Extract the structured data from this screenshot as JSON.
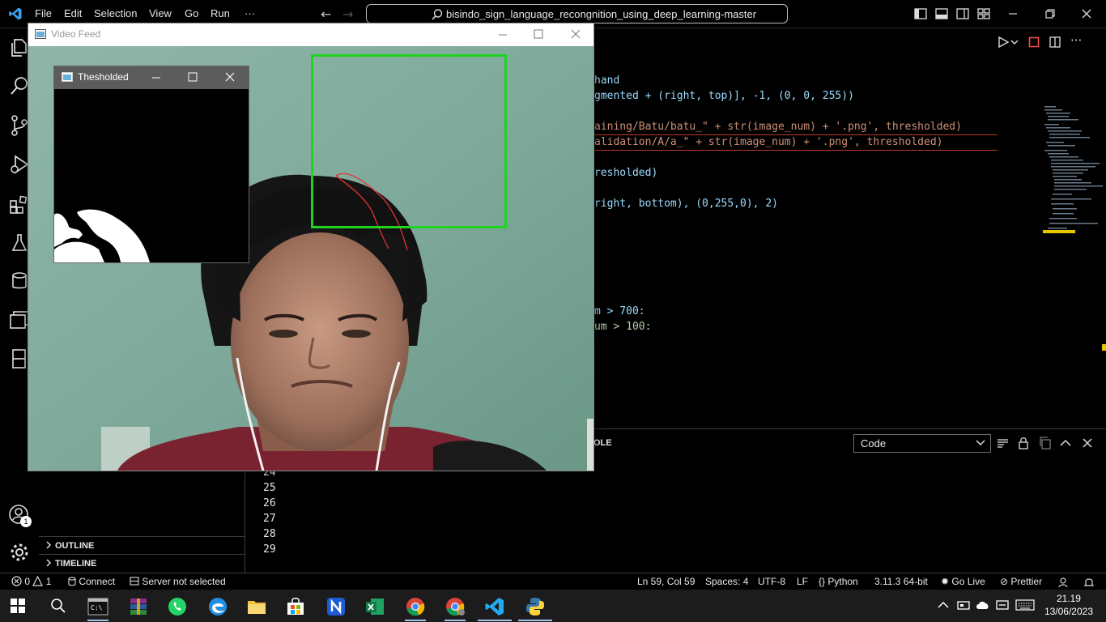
{
  "titlebar": {
    "menus": [
      "File",
      "Edit",
      "Selection",
      "View",
      "Go",
      "Run",
      "···"
    ],
    "search_text": "bisindo_sign_language_recongnition_using_deep_learning-master"
  },
  "code": {
    "lines": [
      {
        "text": "hand"
      },
      {
        "text": "gmented + (right, top)], -1, (0, 0, 255))"
      },
      {
        "text": "aining/Batu/batu_\" + str(image_num) + '.png', thresholded)"
      },
      {
        "text": "alidation/A/a_\" + str(image_num) + '.png', thresholded)"
      },
      {
        "text": "resholded)"
      },
      {
        "text": "right, bottom), (0,255,0), 2)"
      },
      {
        "text": "m > 700:"
      },
      {
        "text": "um > 100:"
      }
    ]
  },
  "panel": {
    "tab_partial": "OLE",
    "select_value": "Code",
    "line_numbers": [
      "24",
      "25",
      "26",
      "27",
      "28",
      "29"
    ]
  },
  "sidebar": {
    "outline_label": "OUTLINE",
    "timeline_label": "TIMELINE"
  },
  "status": {
    "errors": "0",
    "warnings": "1",
    "connect": "Connect",
    "server": "Server not selected",
    "position": "Ln 59, Col 59",
    "spaces": "Spaces: 4",
    "encoding": "UTF-8",
    "eol": "LF",
    "language": "Python",
    "interpreter": "3.11.3 64-bit",
    "golive": "Go Live",
    "prettier": "Prettier"
  },
  "accounts_badge": "1",
  "video_feed": {
    "title": "Video Feed",
    "roi_color": "#1ed41e"
  },
  "thresholded": {
    "title": "Thesholded"
  },
  "taskbar": {
    "time": "21.19",
    "date": "13/06/2023"
  }
}
